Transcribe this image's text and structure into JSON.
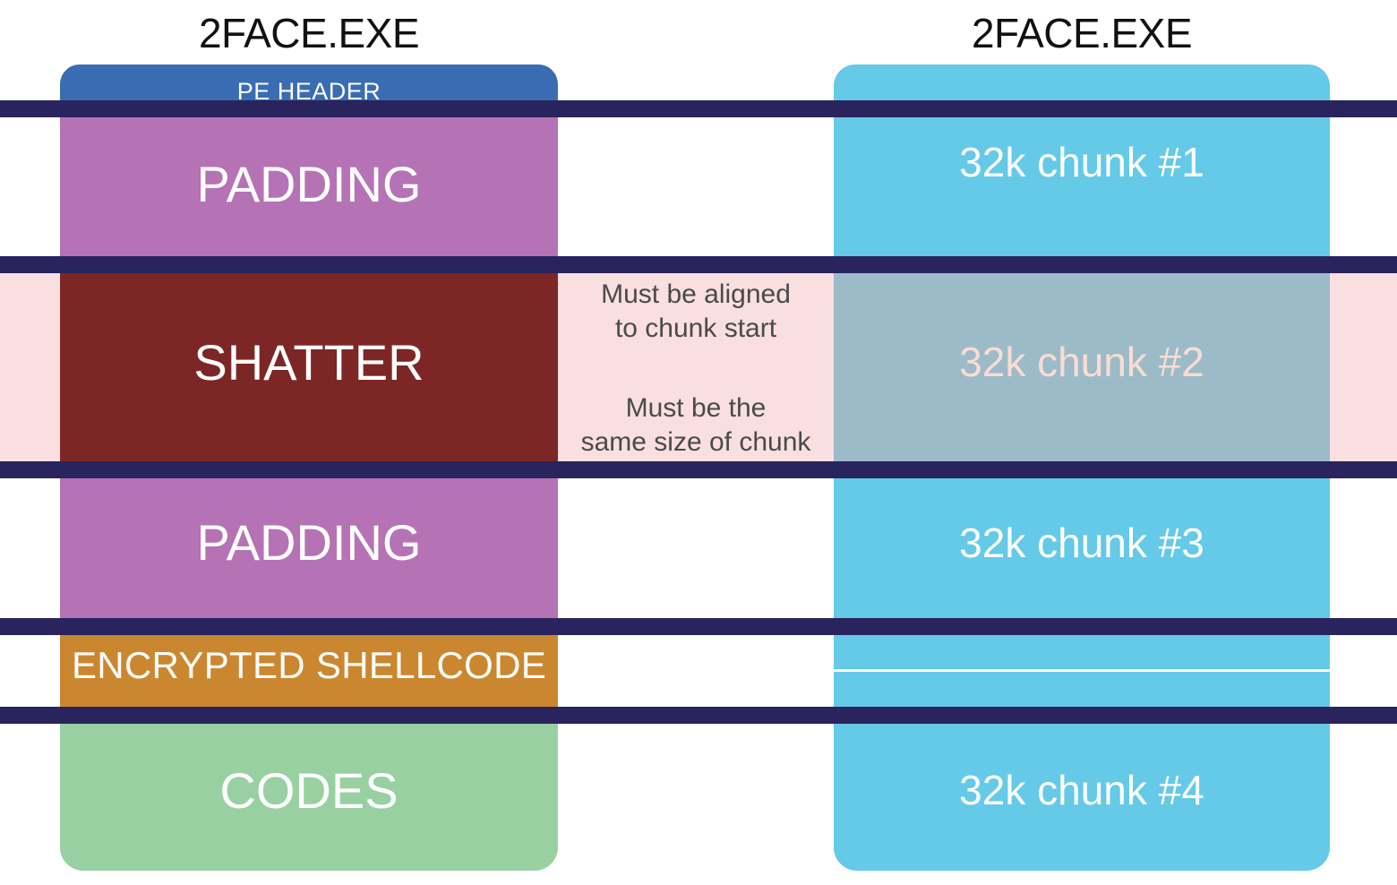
{
  "diagram": {
    "left_column": {
      "title": "2FACE.EXE",
      "segments": [
        {
          "id": "pe-header",
          "label": "PE HEADER",
          "color": "#3a6cb4"
        },
        {
          "id": "padding-1",
          "label": "PADDING",
          "color": "#b573b5"
        },
        {
          "id": "shatter",
          "label": "SHATTER",
          "color": "#7c2726"
        },
        {
          "id": "padding-2",
          "label": "PADDING",
          "color": "#b573b5"
        },
        {
          "id": "shellcode",
          "label": "ENCRYPTED SHELLCODE",
          "color": "#cb8730"
        },
        {
          "id": "codes",
          "label": "CODES",
          "color": "#98d0a2"
        }
      ]
    },
    "right_column": {
      "title": "2FACE.EXE",
      "segments": [
        {
          "id": "chunk-1",
          "label": "32k chunk #1",
          "color": "#65c9e8"
        },
        {
          "id": "chunk-2",
          "label": "32k chunk #2",
          "color": "#9bbbc8"
        },
        {
          "id": "chunk-3",
          "label": "32k chunk #3",
          "color": "#65c9e8"
        },
        {
          "id": "chunk-blank",
          "label": "",
          "color": "#65c9e8"
        },
        {
          "id": "chunk-4",
          "label": "32k chunk #4",
          "color": "#65c9e8"
        }
      ]
    },
    "annotations": {
      "note_1": "Must be aligned\nto chunk start",
      "note_2": "Must be the\nsame size of chunk"
    },
    "colors": {
      "rule": "#29245e",
      "highlight_band": "#fadfe0",
      "highlight_text": "#4a4a4a",
      "chunk2_text": "#fadcd2"
    }
  }
}
